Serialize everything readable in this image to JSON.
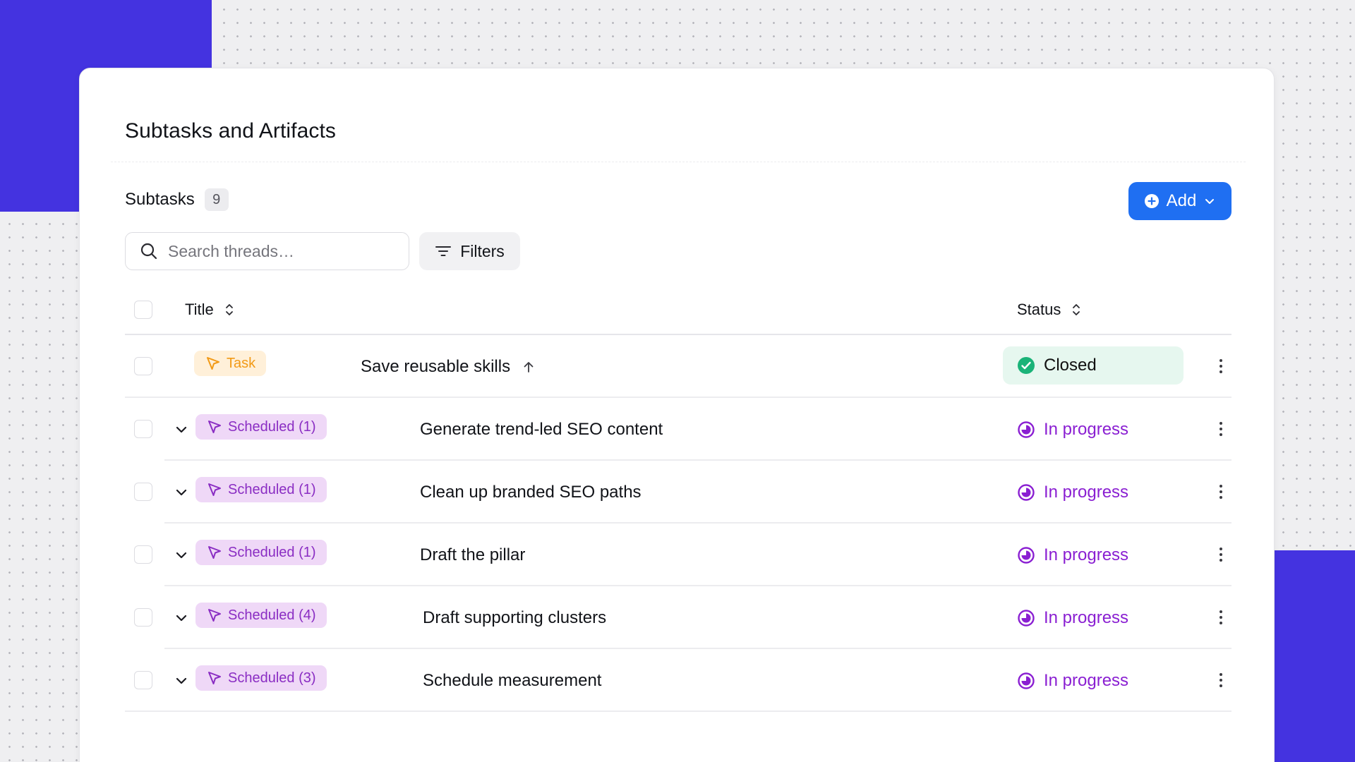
{
  "page": {
    "title": "Subtasks and Artifacts"
  },
  "colors": {
    "accent_block": "#4433e0",
    "primary_button": "#1f6ff2",
    "task_tag": "#f29a16",
    "scheduled_tag": "#8a2dc3",
    "in_progress": "#8a1fd2",
    "closed_check": "#1ab378"
  },
  "subtasks": {
    "label": "Subtasks",
    "count": "9"
  },
  "add_button": {
    "label": "Add",
    "icon": "plus-circle-icon"
  },
  "search": {
    "placeholder": "Search threads…",
    "value": ""
  },
  "filters": {
    "label": "Filters",
    "icon": "filter-lines-icon"
  },
  "table": {
    "columns": {
      "title": "Title",
      "status": "Status"
    },
    "rows": [
      {
        "tag": "Task",
        "title": "Save reusable skills",
        "status": "Closed"
      },
      {
        "tag": "Scheduled (1)",
        "title": "Generate trend-led SEO content",
        "status": "In progress"
      },
      {
        "tag": "Scheduled (1)",
        "title": "Clean up branded SEO paths",
        "status": "In progress"
      },
      {
        "tag": "Scheduled (1)",
        "title": "Draft the pillar",
        "status": "In progress"
      },
      {
        "tag": "Scheduled (4)",
        "title": "Draft supporting clusters",
        "status": "In progress"
      },
      {
        "tag": "Scheduled (3)",
        "title": "Schedule measurement",
        "status": "In progress"
      }
    ]
  }
}
